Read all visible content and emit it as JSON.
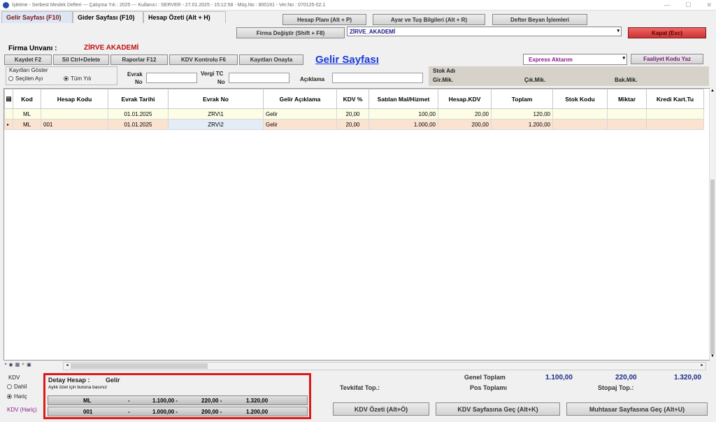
{
  "window": {
    "title": "İşletme - Serbest Meslek Defteri  ---  Çalışma Yılı : 2025  ---  Kullanıcı : SERVER - 27.01.2025 - 15:12:58 - Müş.No : 800191 - Ver.No : 070125-02.1"
  },
  "tabs": [
    "Gelir Sayfası (F10)",
    "Gider Sayfası (F10)",
    "Hesap Özeti (Alt + H)"
  ],
  "top_buttons": {
    "hesap_plani": "Hesap Planı (Alt + P)",
    "ayar": "Ayar ve Tuş Bilgileri (Alt + R)",
    "defter": "Defter Beyan İşlemleri",
    "firma_degistir": "Firma Değiştir (Shift + F8)",
    "kapat": "Kapat (Esc)"
  },
  "firm": {
    "selected": "ZİRVE_AKADEMİ",
    "label": "Firma Unvanı :",
    "name": "ZİRVE AKADEMİ"
  },
  "toolbar": {
    "kaydet": "Kaydet F2",
    "sil": "Sil Ctrl+Delete",
    "raporlar": "Raporlar F12",
    "kdv_kontrol": "KDV Kontrolu F6",
    "kayitlari_onayla": "Kayıtları Onayla"
  },
  "page_title": "Gelir Sayfası",
  "express": {
    "selected": "Express Aktarım",
    "faaliyet": "Faaliyet Kodu Yaz"
  },
  "filters": {
    "kayitlari_goster": "Kayıtları Göster",
    "secilen_ay": "Seçilen Ayı",
    "tum_yil": "Tüm Yılı",
    "evrak_no_1": "Evrak",
    "evrak_no_2": "No",
    "vergi_1": "Vergi TC",
    "vergi_2": "No",
    "aciklama": "Açıklama",
    "stok_adi": "Stok Adı",
    "gir_mik": "Gir.Mik.",
    "cik_mik": "Çık.Mik.",
    "bak_mik": "Bak.Mik."
  },
  "table": {
    "headers": [
      "Kod",
      "Hesap Kodu",
      "Evrak Tarihi",
      "Evrak No",
      "Gelir Açıklama",
      "KDV %",
      "Satılan Mal/Hizmet",
      "Hesap.KDV",
      "Toplam",
      "Stok Kodu",
      "Miktar",
      "Kredi Kart.Tu"
    ],
    "rows": [
      [
        "ML",
        "",
        "01.01.2025",
        "ZRV\\1",
        "Gelir",
        "20,00",
        "100,00",
        "20,00",
        "120,00",
        "",
        "",
        ""
      ],
      [
        "ML",
        "001",
        "01.01.2025",
        "ZRV\\2",
        "Gelir",
        "20,00",
        "1.000,00",
        "200,00",
        "1.200,00",
        "",
        "",
        ""
      ]
    ]
  },
  "kdv": {
    "title": "KDV",
    "dahil": "Dahil",
    "haric": "Hariç",
    "status": "KDV (Hariç)"
  },
  "detail": {
    "title": "Detay Hesap :",
    "value": "Gelir",
    "hint": "Aylık özet için butona basınız",
    "rows": [
      {
        "code": "ML",
        "dash": "-",
        "a": "1.100,00 -",
        "b": "220,00 -",
        "c": "1.320,00"
      },
      {
        "code": "001",
        "dash": "-",
        "a": "1.000,00 -",
        "b": "200,00 -",
        "c": "1.200,00"
      }
    ]
  },
  "totals": {
    "genel_label": "Genel Toplam",
    "genel_1": "1.100,00",
    "genel_2": "220,00",
    "genel_3": "1.320,00",
    "tevkifat_label": "Tevkifat  Top.:",
    "pos_label": "Pos Toplamı",
    "stopaj_label": "Stopaj  Top.:"
  },
  "bottom_buttons": {
    "kdv_ozeti": "KDV Özeti (Alt+Ö)",
    "kdv_sayfa": "KDV Sayfasına Geç (Alt+K)",
    "muhtasar": "Muhtasar Sayfasına Geç (Alt+U)"
  }
}
